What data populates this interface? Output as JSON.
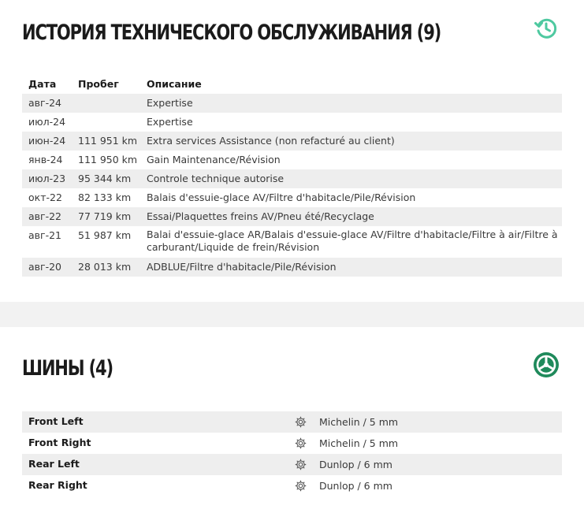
{
  "maintenance": {
    "title": "ИСТОРИЯ ТЕХНИЧЕСКОГО ОБСЛУЖИВАНИЯ (9)",
    "icon": "history-icon",
    "accent": "#4ec9a0",
    "headers": {
      "date": "Дата",
      "mileage": "Пробег",
      "description": "Описание"
    },
    "rows": [
      {
        "date": "авг-24",
        "mileage": "",
        "description": "Expertise"
      },
      {
        "date": "июл-24",
        "mileage": "",
        "description": "Expertise"
      },
      {
        "date": "июн-24",
        "mileage": "111 951 km",
        "description": "Extra services Assistance (non refacturé au client)"
      },
      {
        "date": "янв-24",
        "mileage": "111 950 km",
        "description": "Gain Maintenance/Révision"
      },
      {
        "date": "июл-23",
        "mileage": "95 344 km",
        "description": "Controle technique autorise"
      },
      {
        "date": "окт-22",
        "mileage": "82 133 km",
        "description": "Balais d'essuie-glace AV/Filtre d'habitacle/Pile/Révision"
      },
      {
        "date": "авг-22",
        "mileage": "77 719 km",
        "description": "Essai/Plaquettes freins AV/Pneu été/Recyclage"
      },
      {
        "date": "авг-21",
        "mileage": "51 987 km",
        "description": "Balai d'essuie-glace AR/Balais d'essuie-glace AV/Filtre d'habitacle/Filtre à air/Filtre à carburant/Liquide de frein/Révision"
      },
      {
        "date": "авг-20",
        "mileage": "28 013 km",
        "description": "ADBLUE/Filtre d'habitacle/Pile/Révision"
      }
    ]
  },
  "tires": {
    "title": "ШИНЫ (4)",
    "icon": "tire-wheel-icon",
    "accent": "#1f8a5b",
    "rows": [
      {
        "position": "Front Left",
        "icon": "gear-icon",
        "value": "Michelin / 5 mm"
      },
      {
        "position": "Front Right",
        "icon": "gear-icon",
        "value": "Michelin / 5 mm"
      },
      {
        "position": "Rear Left",
        "icon": "gear-icon",
        "value": "Dunlop / 6 mm"
      },
      {
        "position": "Rear Right",
        "icon": "gear-icon",
        "value": "Dunlop / 6 mm"
      }
    ]
  }
}
